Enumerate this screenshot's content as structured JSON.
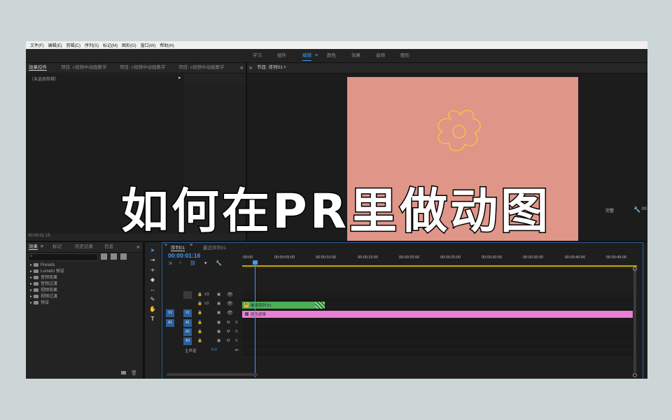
{
  "menu": [
    "文件(F)",
    "编辑(E)",
    "剪辑(C)",
    "序列(S)",
    "标记(M)",
    "图形(G)",
    "窗口(W)",
    "帮助(H)"
  ],
  "workspaces": [
    {
      "label": "学习",
      "active": false
    },
    {
      "label": "组件",
      "active": false
    },
    {
      "label": "编辑",
      "active": true
    },
    {
      "label": "颜色",
      "active": false
    },
    {
      "label": "效果",
      "active": false
    },
    {
      "label": "音频",
      "active": false
    },
    {
      "label": "图形",
      "active": false
    }
  ],
  "workspace_menu_icon": "≡",
  "source_panel": {
    "tabs": [
      "效果控件",
      "项目: c视频中动画教学",
      "项目: c视频中动画教学",
      "项目: c视频中动画教学"
    ],
    "overflow": "»",
    "no_clip": "（未选择剪辑）",
    "arrow": "▸",
    "timecode": "00:00:01:15"
  },
  "program_panel": {
    "overflow": "»",
    "title": "节目: 序列01",
    "title_menu": "≡",
    "fit": "完整",
    "right_timecode_fragment": "00"
  },
  "effects_panel": {
    "tabs": [
      "效果",
      "标记",
      "历史记录",
      "信息"
    ],
    "tab_menu": "≡",
    "overflow": "»",
    "search_icon": "search-icon",
    "items": [
      "Presets",
      "Lumetri 预设",
      "音频效果",
      "音频过渡",
      "视频效果",
      "视频过渡",
      "预设"
    ]
  },
  "timeline": {
    "close": "×",
    "tabs": [
      "序列01",
      "最近序列01"
    ],
    "tab_menu": "≡",
    "timecode": "00:00:01:16",
    "ruler": [
      ":00:00",
      "00:00:05:00",
      "00:00:10:00",
      "00:00:15:00",
      "00:00:20:00",
      "00:00:25:00",
      "00:00:30:00",
      "00:00:35:00",
      "00:00:40:00",
      "00:00:45:00"
    ],
    "video_tracks": [
      {
        "label": "V3",
        "source": ""
      },
      {
        "label": "V2",
        "source": ""
      },
      {
        "label": "V1",
        "source": "V1"
      }
    ],
    "audio_tracks": [
      {
        "label": "A1",
        "source": "A1"
      },
      {
        "label": "A2",
        "source": ""
      },
      {
        "label": "A3",
        "source": ""
      }
    ],
    "master_label": "主声道",
    "master_value": "0.0",
    "track_m": "M",
    "track_s": "S",
    "clip_green": "嵌套序列 01",
    "clip_green_fx": "fx",
    "clip_pink": "颜色遮罩"
  },
  "overlay_title": "如何在PR里做动图",
  "colors": {
    "accent": "#3f9bf3",
    "frame": "#df9588",
    "flower": "#f2c04a",
    "clip_green": "#4caf56",
    "clip_pink": "#e97fd4"
  }
}
